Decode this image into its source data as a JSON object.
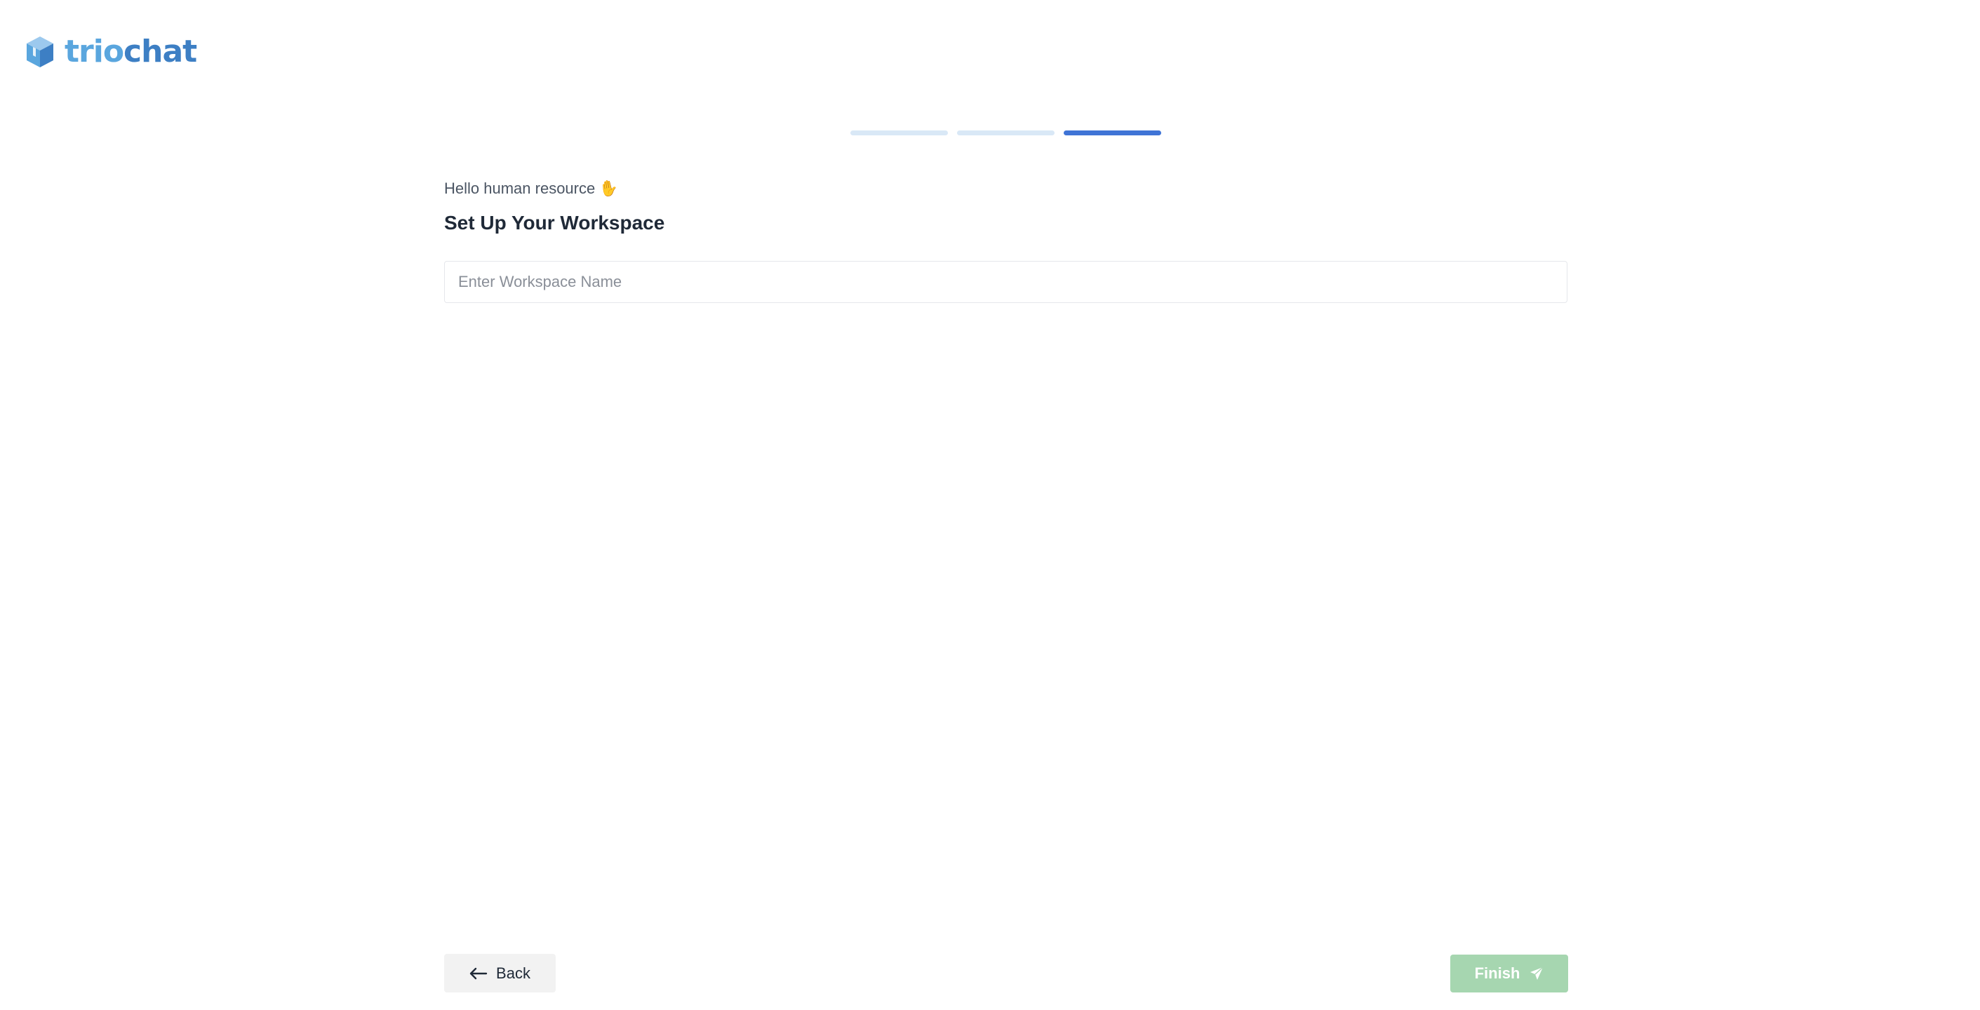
{
  "brand": {
    "logo_part1": "trio",
    "logo_part2": "chat",
    "colors": {
      "light": "#5aa6de",
      "dark": "#3d7fc4"
    }
  },
  "progress": {
    "total_steps": 3,
    "current_step": 3,
    "active_color": "#3f74d6",
    "inactive_color": "#d9e8f6"
  },
  "main": {
    "greeting": "Hello human resource",
    "greeting_icon": "waving-hand-icon",
    "title": "Set Up Your Workspace",
    "workspace_input": {
      "value": "",
      "placeholder": "Enter Workspace Name"
    }
  },
  "footer": {
    "back_label": "Back",
    "back_icon": "arrow-left-icon",
    "finish_label": "Finish",
    "finish_icon": "send-icon",
    "finish_color": "#a6d6b0"
  }
}
